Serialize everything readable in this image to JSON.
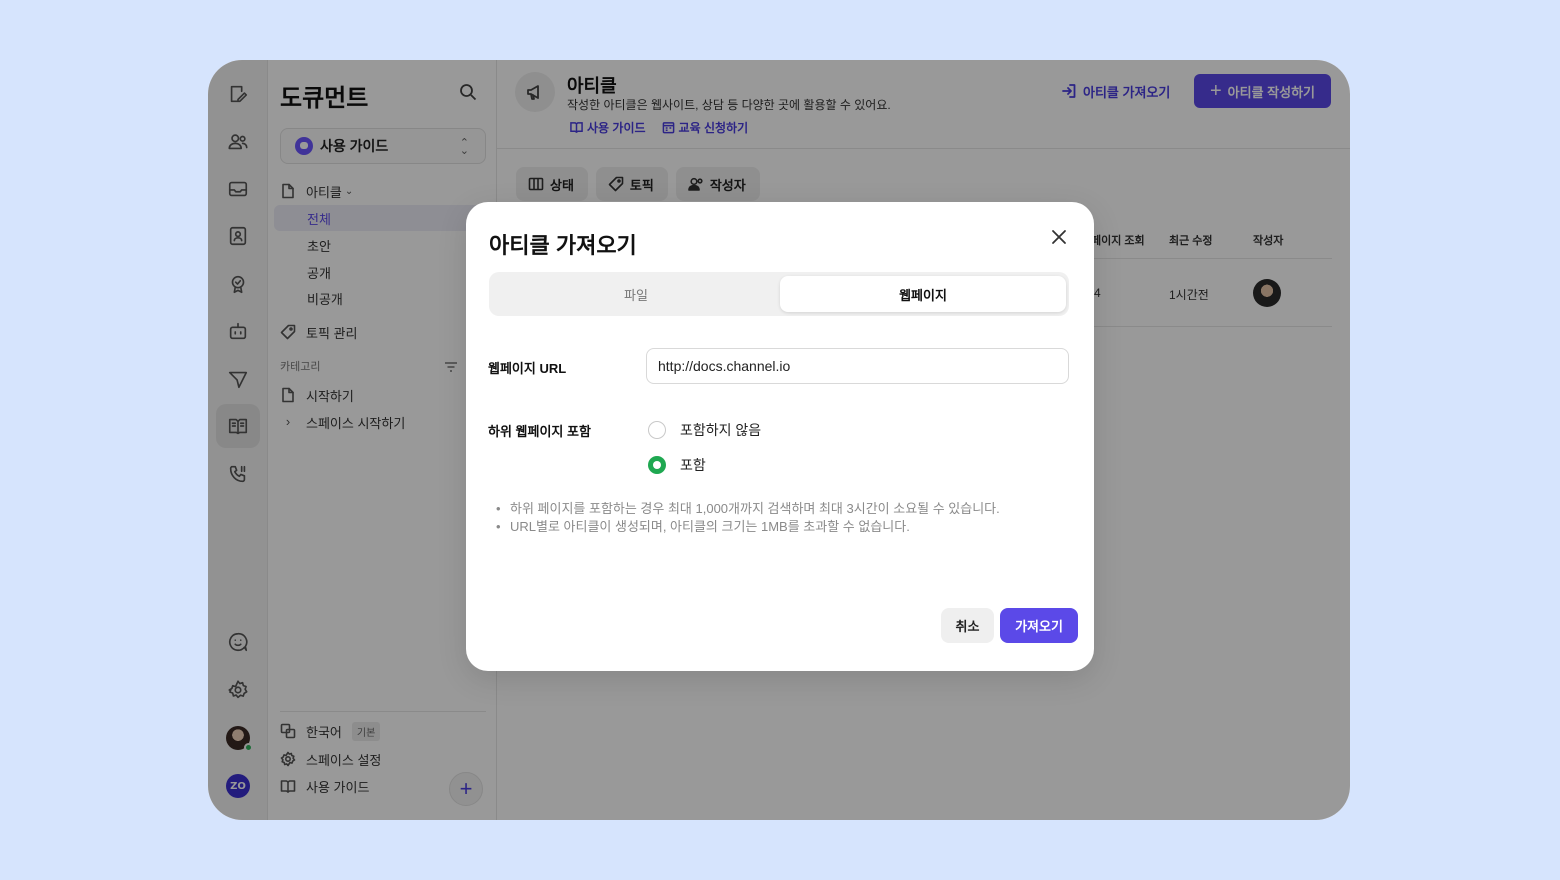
{
  "rail": {
    "icons": [
      "compose-icon",
      "users-icon",
      "inbox-icon",
      "contact-card-icon",
      "badge-icon",
      "bot-icon",
      "send-icon",
      "book-icon",
      "phone-icon",
      "chat-face-icon",
      "gear-icon"
    ],
    "active": "book-icon",
    "org_badge": "ZO"
  },
  "sidebar": {
    "title": "도큐먼트",
    "space": "사용 가이드",
    "articles_label": "아티클",
    "article_filters": [
      "전체",
      "초안",
      "공개",
      "비공개"
    ],
    "active_filter": "전체",
    "topic_manage": "토픽 관리",
    "category_header": "카테고리",
    "categories": [
      "시작하기",
      "스페이스 시작하기"
    ],
    "footer": {
      "language": "한국어",
      "language_badge": "기본",
      "space_settings": "스페이스 설정",
      "user_guide": "사용 가이드"
    }
  },
  "header": {
    "title": "아티클",
    "description": "작성한 아티클은 웹사이트, 상담 등 다양한 곳에 활용할 수 있어요.",
    "links": [
      "사용 가이드",
      "교육 신청하기"
    ],
    "import_button": "아티클 가져오기",
    "write_button": "아티클 작성하기"
  },
  "filters": [
    "상태",
    "토픽",
    "작성자"
  ],
  "table": {
    "columns": [
      "페이지 조회",
      "최근 수정",
      "작성자"
    ],
    "rows": [
      {
        "views": "4",
        "modified": "1시간전"
      }
    ]
  },
  "modal": {
    "title": "아티클 가져오기",
    "tabs": [
      "파일",
      "웹페이지"
    ],
    "active_tab": "웹페이지",
    "url_label": "웹페이지 URL",
    "url_value": "http://docs.channel.io",
    "include_label": "하위 웹페이지 포함",
    "options": [
      "포함하지 않음",
      "포함"
    ],
    "selected_option": "포함",
    "notes": [
      "하위 페이지를 포함하는 경우 최대 1,000개까지 검색하며 최대 3시간이 소요될 수 있습니다.",
      "URL별로 아티클이 생성되며, 아티클의 크기는 1MB를 초과할 수 없습니다."
    ],
    "cancel": "취소",
    "confirm": "가져오기"
  },
  "colors": {
    "accent": "#5b49e8",
    "radio_on": "#1fa851",
    "background": "#d6e4fd"
  }
}
